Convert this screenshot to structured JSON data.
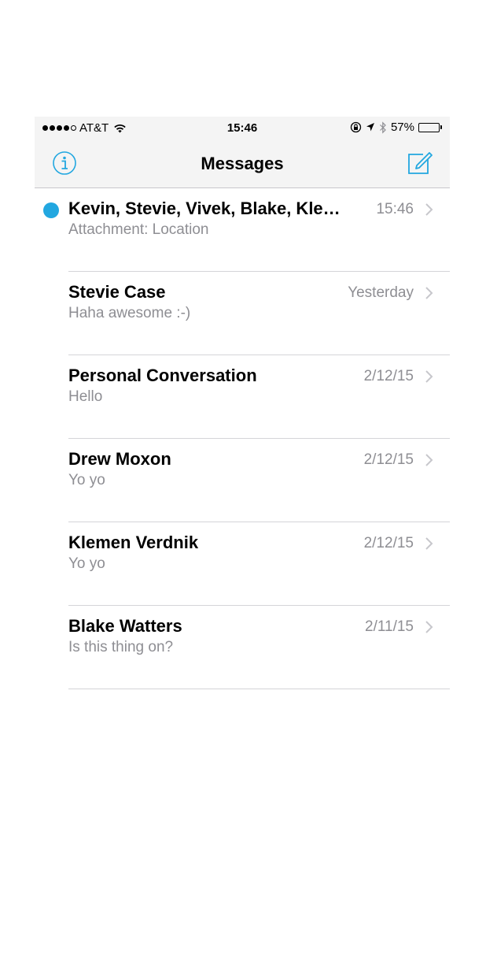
{
  "status_bar": {
    "carrier": "AT&T",
    "time": "15:46",
    "battery": "57%",
    "battery_level": 0.57
  },
  "nav": {
    "title": "Messages"
  },
  "accent_color": "#22a7e0",
  "conversations": [
    {
      "name": "Kevin, Stevie, Vivek, Blake, Kle…",
      "preview": "Attachment: Location",
      "time": "15:46",
      "unread": true
    },
    {
      "name": "Stevie Case",
      "preview": "Haha awesome :-)",
      "time": "Yesterday",
      "unread": false
    },
    {
      "name": "Personal Conversation",
      "preview": "Hello",
      "time": "2/12/15",
      "unread": false
    },
    {
      "name": "Drew Moxon",
      "preview": "Yo yo",
      "time": "2/12/15",
      "unread": false
    },
    {
      "name": "Klemen Verdnik",
      "preview": "Yo yo",
      "time": "2/12/15",
      "unread": false
    },
    {
      "name": "Blake Watters",
      "preview": "Is this thing on?",
      "time": "2/11/15",
      "unread": false
    }
  ]
}
